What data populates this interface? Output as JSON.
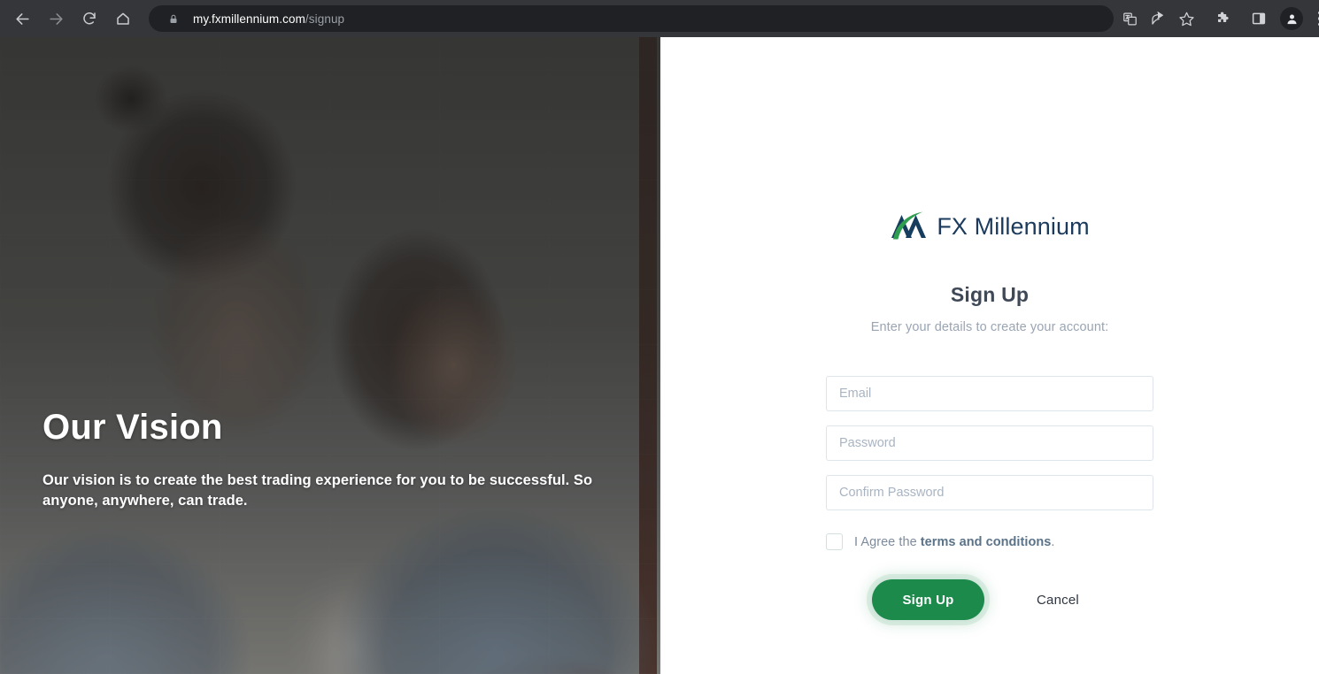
{
  "browser": {
    "back_icon": "back-arrow-icon",
    "forward_icon": "forward-arrow-icon",
    "reload_icon": "reload-icon",
    "home_icon": "home-icon",
    "lock_icon": "lock-icon",
    "url_domain": "my.fxmillennium.com",
    "url_path": "/signup",
    "toolbar_icons": [
      "translate-icon",
      "share-icon",
      "bookmark-star-icon",
      "extensions-puzzle-icon",
      "side-panel-icon",
      "profile-avatar-icon",
      "three-dot-menu-icon"
    ],
    "colors": {
      "chrome_bg": "#35363a",
      "omnibox_bg": "#202124",
      "url_domain_color": "#ffffff",
      "url_path_color": "#9aa0a6"
    }
  },
  "hero": {
    "title": "Our Vision",
    "subtitle": "Our vision is to create the best trading experience for you to be successful. So anyone, anywhere, can trade.",
    "image_alt": "two-people-smiling-photo",
    "overlay_color": "#202020"
  },
  "brand": {
    "logo_icon": "fx-millennium-mountain-logo-icon",
    "name": "FX Millennium",
    "name_color": "#1b3a5c",
    "mark_navy": "#173d5e",
    "mark_green": "#2f9e4f"
  },
  "form": {
    "title": "Sign Up",
    "subtitle": "Enter your details to create your account:",
    "fields": [
      {
        "name": "email",
        "placeholder": "Email",
        "value": ""
      },
      {
        "name": "password",
        "placeholder": "Password",
        "value": ""
      },
      {
        "name": "confirm_password",
        "placeholder": "Confirm Password",
        "value": ""
      }
    ],
    "terms": {
      "checked": false,
      "prefix": "I Agree the ",
      "link": "terms and conditions",
      "suffix": "."
    },
    "actions": {
      "submit_label": "Sign Up",
      "cancel_label": "Cancel",
      "submit_color": "#1b8a4b",
      "cancel_color": "#2f3640"
    }
  }
}
